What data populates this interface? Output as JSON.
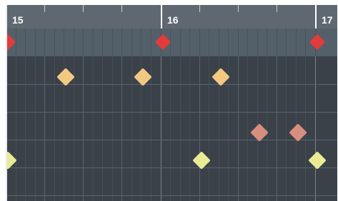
{
  "ruler": {
    "labels": [
      "15",
      "16",
      "17"
    ]
  },
  "colors": {
    "ruler_bg": "#5f6870",
    "lane_bg": "#536069",
    "grid_bg": "#3a4149",
    "event_red": "#e23b3b",
    "event_orange": "#f3c982",
    "event_salmon": "#d88e7e",
    "event_yellow": "#eaeb95"
  },
  "automation_events": [
    {
      "bar": 15.0,
      "color": "red"
    },
    {
      "bar": 16.0,
      "color": "red"
    },
    {
      "bar": 17.0,
      "color": "red"
    }
  ],
  "note_events": [
    {
      "row": 1,
      "bar": 15.375,
      "color": "orange"
    },
    {
      "row": 1,
      "bar": 15.875,
      "color": "orange"
    },
    {
      "row": 1,
      "bar": 16.375,
      "color": "orange"
    },
    {
      "row": 3,
      "bar": 16.625,
      "color": "salmon"
    },
    {
      "row": 3,
      "bar": 16.875,
      "color": "salmon"
    },
    {
      "row": 4,
      "bar": 15.0,
      "color": "yellow"
    },
    {
      "row": 4,
      "bar": 16.25,
      "color": "yellow"
    },
    {
      "row": 4,
      "bar": 17.0,
      "color": "yellow"
    }
  ]
}
